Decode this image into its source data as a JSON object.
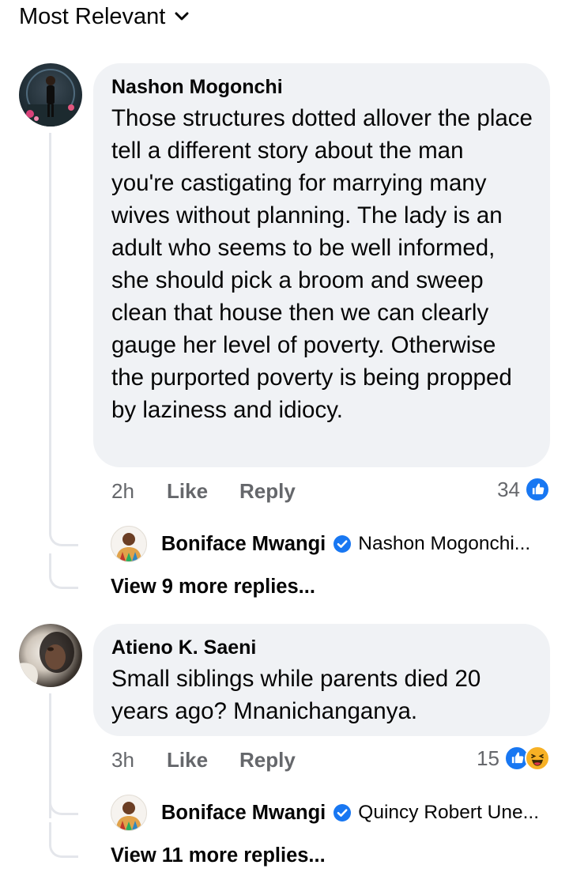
{
  "sort": {
    "label": "Most Relevant",
    "icon": "chevron-down-icon"
  },
  "comments": [
    {
      "author": "Nashon Mogonchi",
      "text": "Those structures dotted allover the place tell a different story about the man you're castigating for marrying many wives without planning. The lady is an adult who seems to be well informed, she should pick a broom and sweep clean that house then we can clearly gauge her level of poverty. Otherwise the purported poverty is being propped by laziness and idiocy.",
      "time": "2h",
      "like_label": "Like",
      "reply_label": "Reply",
      "reaction_count": "34",
      "reactions": [
        "like-icon"
      ],
      "reply_preview": {
        "author": "Boniface Mwangi",
        "verified": true,
        "text": "Nashon Mogonchi..."
      },
      "view_more": "View 9 more replies..."
    },
    {
      "author": "Atieno K. Saeni",
      "text": "Small siblings while parents died 20 years ago? Mnanichanganya.",
      "time": "3h",
      "like_label": "Like",
      "reply_label": "Reply",
      "reaction_count": "15",
      "reactions": [
        "like-icon",
        "haha-icon"
      ],
      "reply_preview": {
        "author": "Boniface Mwangi",
        "verified": true,
        "text": "Quincy Robert Une..."
      },
      "view_more": "View 11 more replies..."
    }
  ],
  "colors": {
    "bubble": "#f0f2f5",
    "meta_text": "#65676b",
    "like_blue": "#1877f2",
    "verified_blue": "#1877f2",
    "haha_yellow": "#f7b125",
    "thread_line": "#e4e6eb"
  }
}
